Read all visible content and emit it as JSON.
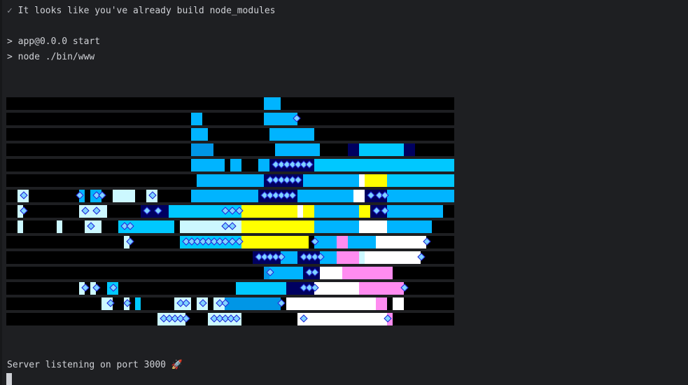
{
  "terminal": {
    "prev_line": "   ~ ~ ~ ~ ~ ~ ~ ~ ~ ~ ~ ~ ~ ~ ~ ~ ~ ~ ~ ~ ~",
    "check_mark": "✓",
    "line1": " It looks like you've already build node_modules",
    "line2": "> app@0.0.0 start",
    "line3": "> node ./bin/www",
    "server_line": "Server listening on port 3000 🚀"
  },
  "colors": {
    "background": "#1e1f22",
    "text": "#cfd1d6",
    "art_background": "#000000",
    "cyan": "#00b4ff",
    "light_blue": "#00c8ff",
    "mid_blue": "#0096e6",
    "navy": "#000060",
    "yellow": "#ffff00",
    "white": "#ffffff",
    "pink": "#ff8cf0",
    "pale_cyan": "#ccf8ff"
  }
}
